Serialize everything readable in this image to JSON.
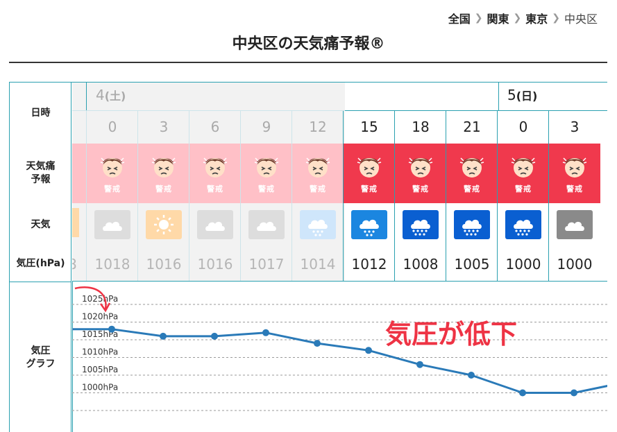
{
  "breadcrumb": {
    "items": [
      "全国",
      "関東",
      "東京"
    ],
    "current": "中央区"
  },
  "title": "中央区の天気痛予報®",
  "row_labels": {
    "datetime": "日時",
    "pain_line1": "天気痛",
    "pain_line2": "予報",
    "weather": "天気",
    "pressure": "気圧(hPa)",
    "graph_line1": "気圧",
    "graph_line2": "グラフ"
  },
  "days": [
    {
      "num": "4",
      "dow": "(土)",
      "past": true
    },
    {
      "num": "5",
      "dow": "(日)",
      "past": false
    }
  ],
  "partial": {
    "pressure": "8"
  },
  "columns": [
    {
      "hour": "0",
      "pain": "警戒",
      "weather": "cloudy",
      "pressure": "1018",
      "past": true
    },
    {
      "hour": "3",
      "pain": "警戒",
      "weather": "sunny",
      "pressure": "1016",
      "past": true
    },
    {
      "hour": "6",
      "pain": "警戒",
      "weather": "cloudy",
      "pressure": "1016",
      "past": true
    },
    {
      "hour": "9",
      "pain": "警戒",
      "weather": "cloudy",
      "pressure": "1017",
      "past": true
    },
    {
      "hour": "12",
      "pain": "警戒",
      "weather": "rain",
      "pressure": "1014",
      "past": true
    },
    {
      "hour": "15",
      "pain": "警戒",
      "weather": "rain",
      "pressure": "1012",
      "past": false
    },
    {
      "hour": "18",
      "pain": "警戒",
      "weather": "heavyrain",
      "pressure": "1008",
      "past": false
    },
    {
      "hour": "21",
      "pain": "警戒",
      "weather": "heavyrain",
      "pressure": "1005",
      "past": false
    },
    {
      "hour": "0",
      "pain": "警戒",
      "weather": "heavyrain",
      "pressure": "1000",
      "past": false
    },
    {
      "hour": "3",
      "pain": "警戒",
      "weather": "cloudy",
      "pressure": "1000",
      "past": false
    }
  ],
  "colors": {
    "warn": "#f0394d",
    "warn_past": "#ffc0c7",
    "line": "#2a7ab8",
    "annotation": "#ee3344",
    "border": "#2aa0b0"
  },
  "chart_data": {
    "type": "line",
    "x": [
      "",
      "0",
      "3",
      "6",
      "9",
      "12",
      "15",
      "18",
      "21",
      "0",
      "3",
      ""
    ],
    "series": [
      {
        "values": [
          1018,
          1018,
          1016,
          1016,
          1017,
          1014,
          1012,
          1008,
          1005,
          1000,
          1000,
          1003
        ]
      }
    ],
    "y_ticks": [
      "1025hPa",
      "1020hPa",
      "1015hPa",
      "1010hPa",
      "1005hPa",
      "1000hPa"
    ],
    "ylim": [
      995,
      1025
    ],
    "grid": true,
    "annotation": "気圧が低下"
  }
}
